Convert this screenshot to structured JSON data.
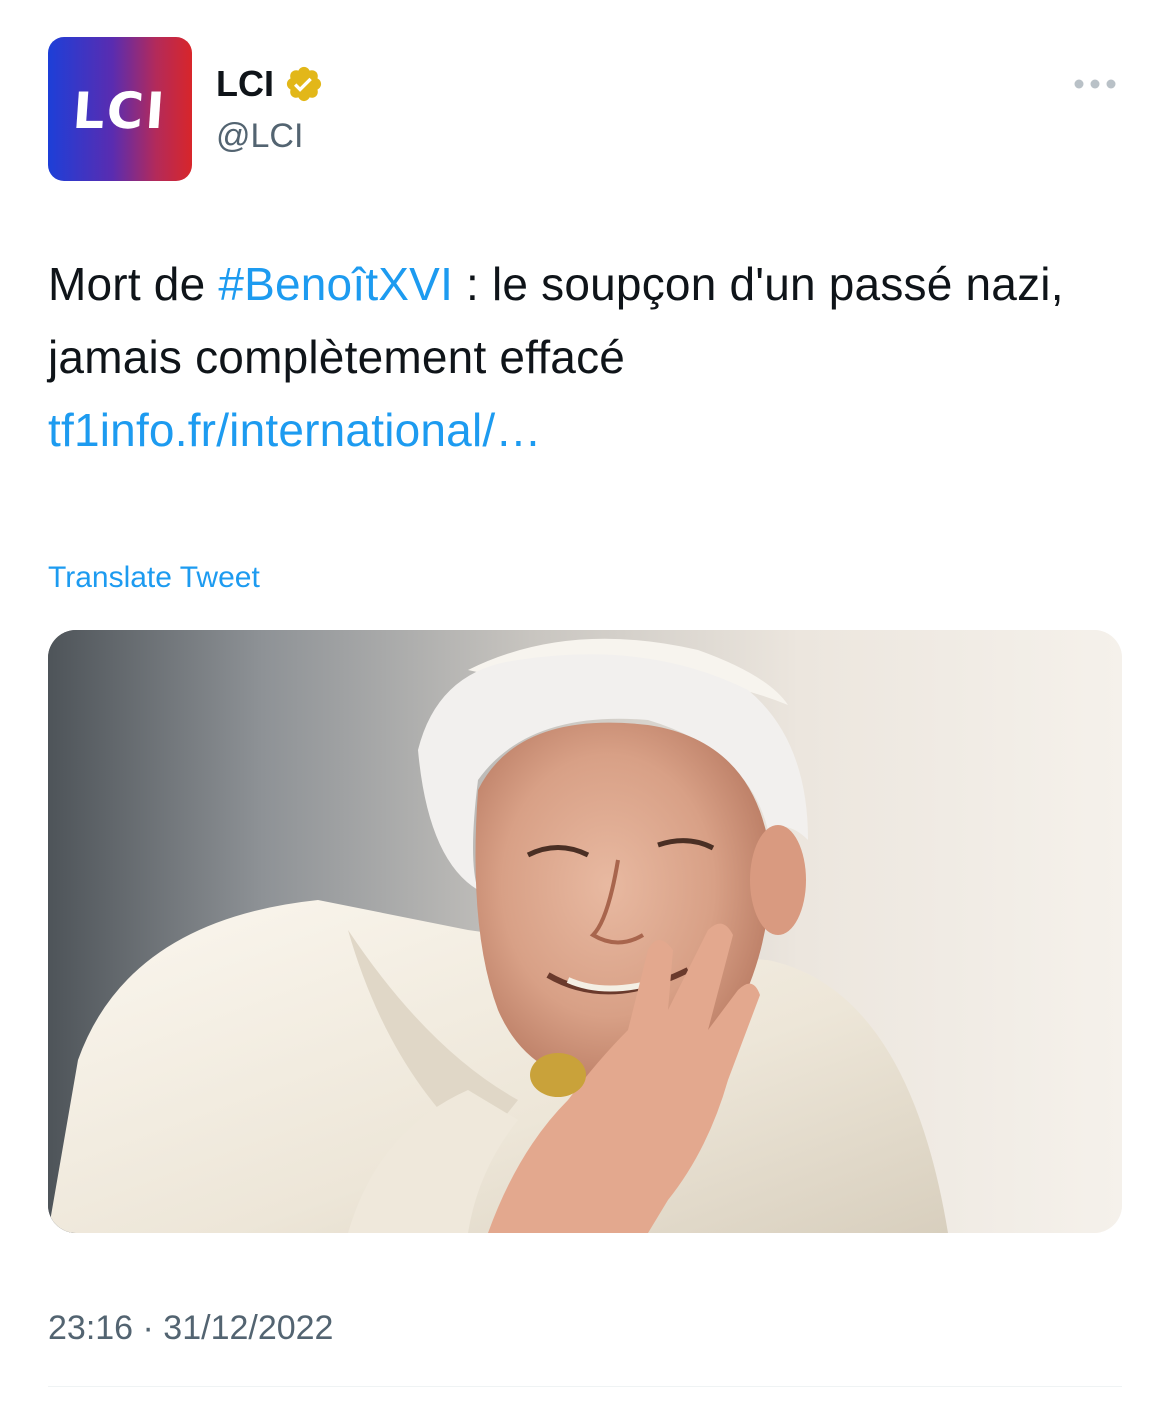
{
  "author": {
    "avatar_text": "LCI",
    "display_name": "LCI",
    "handle": "@LCI",
    "verified": true,
    "verified_color": "#e2b719"
  },
  "tweet": {
    "text_before": "Mort de ",
    "hashtag": "#BenoîtXVI",
    "text_after": " : le soupçon d'un passé nazi, jamais complètement effacé",
    "link": "tf1info.fr/international/…",
    "translate_label": "Translate Tweet",
    "timestamp": "23:16 · 31/12/2022"
  },
  "colors": {
    "link": "#1d9bf0",
    "secondary_text": "#536471"
  },
  "icons": {
    "more": "more-dots-icon",
    "verified": "verified-badge-icon"
  }
}
